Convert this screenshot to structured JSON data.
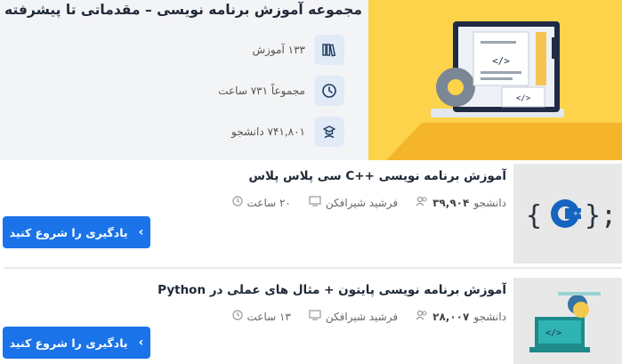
{
  "hero": {
    "title": "مجموعه آموزش برنامه نویسی – مقدماتی تا پیشرفته",
    "stats": [
      {
        "icon": "books-icon",
        "text": "۱۳۳ آموزش"
      },
      {
        "icon": "clock-icon",
        "text": "مجموعاً ۷۳۱ ساعت"
      },
      {
        "icon": "student-icon",
        "text": "۷۴۱,۸۰۱ دانشجو"
      }
    ]
  },
  "courses": [
    {
      "title": "آموزش برنامه نویسی ++C سی پلاس پلاس",
      "students": "۳۹,۹۰۴",
      "students_label": "دانشجو",
      "teacher": "فرشید شیرافکن",
      "duration": "۲۰ ساعت",
      "button_label": "یادگیری را شروع کنید",
      "thumb_text": "{C++;"
    },
    {
      "title": "آموزش برنامه نویسی پایتون + مثال های عملی در Python",
      "students": "۲۸,۰۰۷",
      "students_label": "دانشجو",
      "teacher": "فرشید شیرافکن",
      "duration": "۱۳ ساعت",
      "button_label": "یادگیری را شروع کنید",
      "thumb_text": "</>"
    }
  ],
  "colors": {
    "accent": "#1a73e8",
    "hero_banner": "#fcd34a",
    "hero_bg": "#f3f4f6"
  }
}
